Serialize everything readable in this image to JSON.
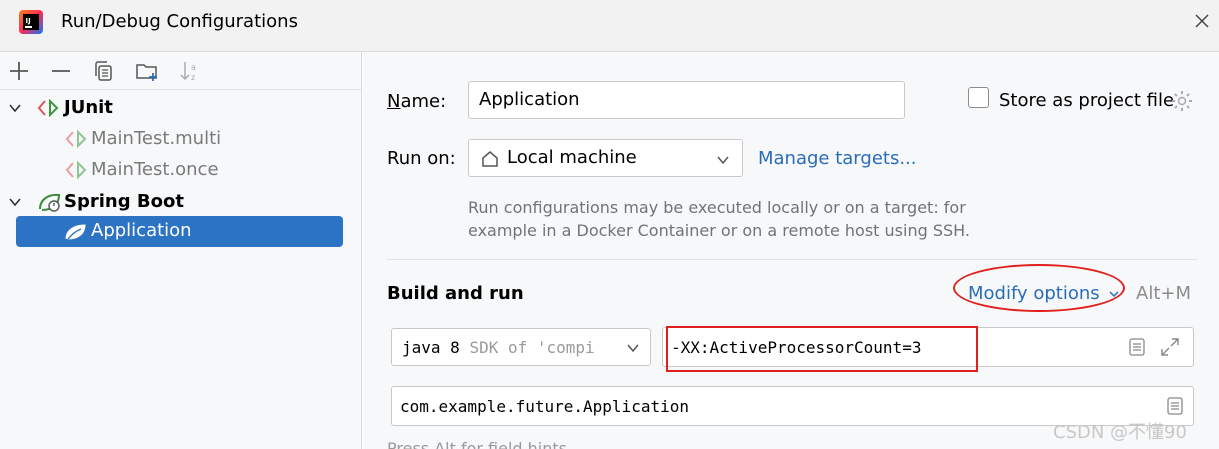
{
  "window": {
    "title": "Run/Debug Configurations"
  },
  "tree": {
    "groups": [
      {
        "label": "JUnit",
        "children": [
          "MainTest.multi",
          "MainTest.once"
        ]
      },
      {
        "label": "Spring Boot",
        "children": [
          "Application"
        ]
      }
    ]
  },
  "form": {
    "name_label_n": "N",
    "name_label_rest": "ame:",
    "name_value": "Application",
    "store_as_project_file": "Store as project file",
    "run_on_label": "Run on:",
    "run_on_value": "Local machine",
    "manage_targets": "Manage targets...",
    "run_hint_line1": "Run configurations may be executed locally or on a target: for",
    "run_hint_line2": "example in a Docker Container or on a remote host using SSH.",
    "build_and_run": "Build and run",
    "modify_options": "Modify options",
    "modify_shortcut": "Alt+M",
    "sdk_java": "java 8",
    "sdk_rest": "SDK of 'compi",
    "vm_options": "-XX:ActiveProcessorCount=3",
    "main_class": "com.example.future.Application",
    "field_hints": "Press Alt for field hints"
  },
  "watermark": "CSDN @不懂90",
  "colors": {
    "accent": "#2d73c4",
    "link": "#2b6cb8",
    "annotation": "#e0201c"
  }
}
